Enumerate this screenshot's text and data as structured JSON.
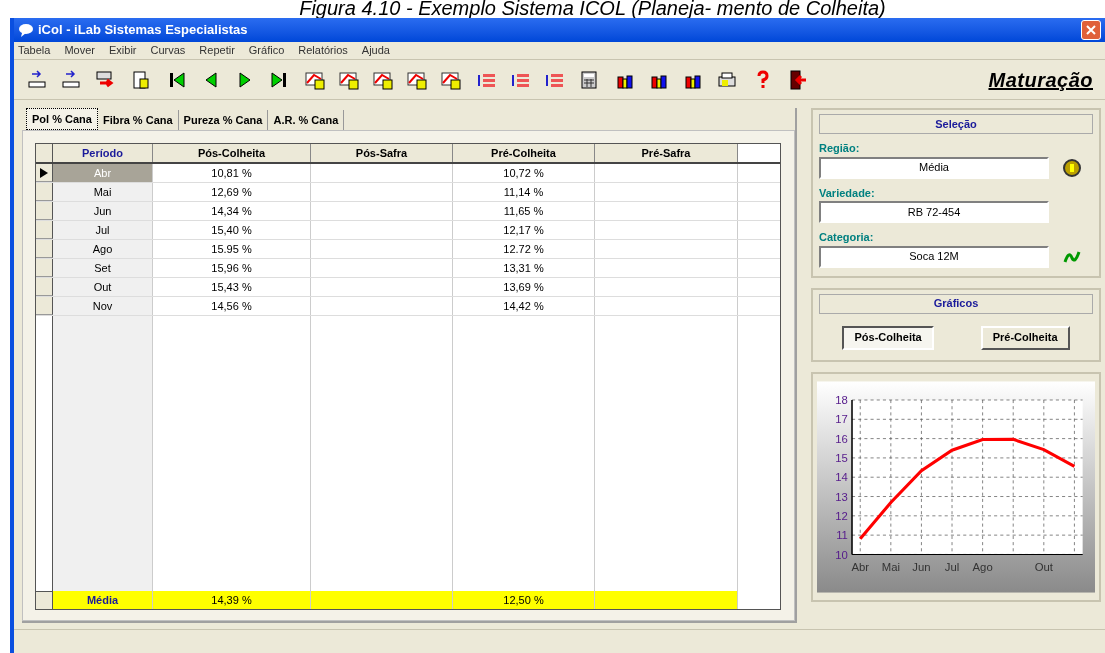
{
  "caption": "Figura 4.10 - Exemplo Sistema ICOL (Planeja- mento de Colheita)",
  "window": {
    "title": "iCol - iLab Sistemas Especialistas"
  },
  "menu": [
    "Tabela",
    "Mover",
    "Exibir",
    "Curvas",
    "Repetir",
    "Gráfico",
    "Relatórios",
    "Ajuda"
  ],
  "toolbar": {
    "title": "Maturação"
  },
  "tabs": [
    {
      "label": "Pol % Cana",
      "selected": true
    },
    {
      "label": "Fibra % Cana",
      "selected": false
    },
    {
      "label": "Pureza % Cana",
      "selected": false
    },
    {
      "label": "A.R. % Cana",
      "selected": false
    }
  ],
  "table": {
    "columns": [
      "Período",
      "Pós-Colheita",
      "Pós-Safra",
      "Pré-Colheita",
      "Pré-Safra"
    ],
    "rows": [
      {
        "period": "Abr",
        "pos_colheita": "10,81 %",
        "pre_colheita": "10,72 %",
        "selected": true
      },
      {
        "period": "Mai",
        "pos_colheita": "12,69 %",
        "pre_colheita": "11,14 %",
        "selected": false
      },
      {
        "period": "Jun",
        "pos_colheita": "14,34 %",
        "pre_colheita": "11,65 %",
        "selected": false
      },
      {
        "period": "Jul",
        "pos_colheita": "15,40 %",
        "pre_colheita": "12,17 %",
        "selected": false
      },
      {
        "period": "Ago",
        "pos_colheita": "15.95 %",
        "pre_colheita": "12.72 %",
        "selected": false
      },
      {
        "period": "Set",
        "pos_colheita": "15,96 %",
        "pre_colheita": "13,31 %",
        "selected": false
      },
      {
        "period": "Out",
        "pos_colheita": "15,43 %",
        "pre_colheita": "13,69 %",
        "selected": false
      },
      {
        "period": "Nov",
        "pos_colheita": "14,56 %",
        "pre_colheita": "14,42 %",
        "selected": false
      }
    ],
    "footer": {
      "period": "Média",
      "pos_colheita": "14,39 %",
      "pre_colheita": "12,50 %"
    }
  },
  "selecao": {
    "title": "Seleção",
    "fields": [
      {
        "label": "Região:",
        "value": "Média",
        "kind": "coin"
      },
      {
        "label": "Variedade:",
        "value": "RB 72-454",
        "kind": "plain"
      },
      {
        "label": "Categoria:",
        "value": "Soca 12M",
        "kind": "plant"
      }
    ]
  },
  "graficos": {
    "title": "Gráficos",
    "buttons": [
      {
        "label": "Pós-Colheita",
        "selected": true
      },
      {
        "label": "Pré-Colheita",
        "selected": false
      }
    ]
  },
  "chart": {
    "chart_data": {
      "type": "line",
      "categories": [
        "Abr",
        "Mai",
        "Jun",
        "Jul",
        "Ago",
        null,
        "Out",
        null
      ],
      "grid": true,
      "series": [
        {
          "color": "#ff0000",
          "values": [
            10.81,
            12.69,
            14.34,
            15.4,
            15.95,
            15.96,
            15.43,
            14.56
          ]
        }
      ],
      "ylim": [
        10,
        18
      ],
      "yticks": [
        10,
        11,
        12,
        13,
        14,
        15,
        16,
        17,
        18
      ]
    }
  }
}
